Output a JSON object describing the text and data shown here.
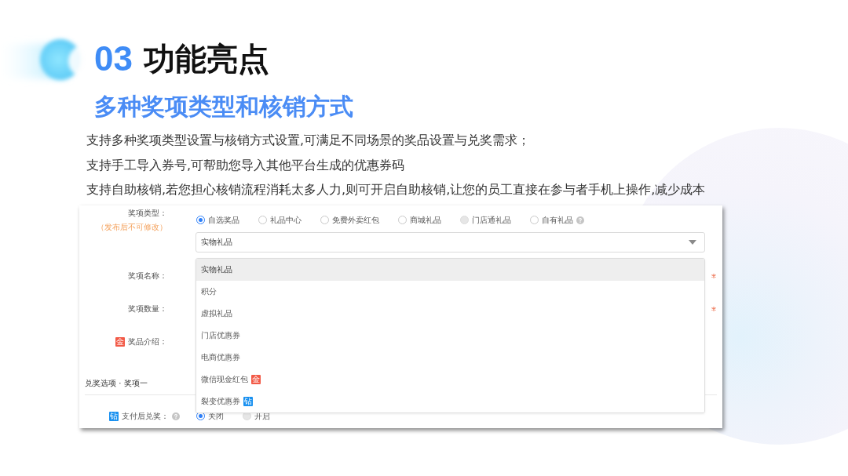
{
  "header": {
    "number": "03",
    "title": "功能亮点",
    "subtitle": "多种奖项类型和核销方式"
  },
  "paragraphs": [
    "支持多种奖项类型设置与核销方式设置,可满足不同场景的奖品设置与兑奖需求；",
    "支持手工导入券号,可帮助您导入其他平台生成的优惠券码",
    "支持自助核销,若您担心核销流程消耗太多人力,则可开启自助核销,让您的员工直接在参与者手机上操作,减少成本"
  ],
  "form": {
    "prize_type": {
      "label": "奖项类型：",
      "note": "（发布后不可修改）",
      "options": [
        {
          "label": "自选奖品",
          "selected": true,
          "disabled": false,
          "help": false
        },
        {
          "label": "礼品中心",
          "selected": false,
          "disabled": false,
          "help": false
        },
        {
          "label": "免费外卖红包",
          "selected": false,
          "disabled": false,
          "help": false
        },
        {
          "label": "商城礼品",
          "selected": false,
          "disabled": false,
          "help": false
        },
        {
          "label": "门店通礼品",
          "selected": false,
          "disabled": true,
          "help": false
        },
        {
          "label": "自有礼品",
          "selected": false,
          "disabled": false,
          "help": true
        }
      ]
    },
    "prize_select": {
      "value": "实物礼品",
      "expanded": true,
      "options": [
        {
          "label": "实物礼品",
          "selected": true
        },
        {
          "label": "积分",
          "selected": false
        },
        {
          "label": "虚拟礼品",
          "selected": false
        },
        {
          "label": "门店优惠券",
          "selected": false
        },
        {
          "label": "电商优惠券",
          "selected": false
        },
        {
          "label": "微信现金红包",
          "selected": false,
          "badge": {
            "text": "金",
            "color": "#f25a47"
          }
        },
        {
          "label": "裂变优惠券",
          "selected": false,
          "badge": {
            "text": "钻",
            "color": "#1890f0"
          }
        }
      ]
    },
    "fields": [
      {
        "label": "奖项名称：",
        "required": true
      },
      {
        "label": "奖项数量：",
        "required": true
      },
      {
        "label": "奖品介绍：",
        "required": false,
        "badge": {
          "text": "金",
          "color": "#f25a47"
        }
      }
    ],
    "section_title": "兑奖选项 · 奖项一",
    "redeem_after_payment": {
      "label": "支付后兑奖：",
      "badge": {
        "text": "钻",
        "color": "#1890f0"
      },
      "help": true,
      "options": [
        {
          "label": "关闭",
          "selected": true,
          "disabled": false
        },
        {
          "label": "开启",
          "selected": false,
          "disabled": true
        }
      ]
    }
  }
}
